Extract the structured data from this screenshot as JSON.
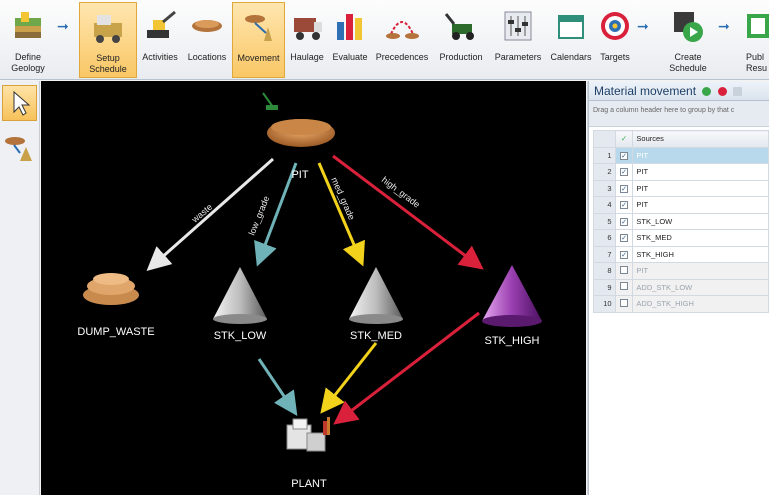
{
  "ribbon": {
    "buttons": [
      {
        "id": "define-geology",
        "label": "Define Geology",
        "icon": "geology-block-icon"
      },
      {
        "id": "setup-schedule",
        "label": "Setup Schedule",
        "icon": "truck-setup-icon"
      },
      {
        "id": "activities",
        "label": "Activities",
        "icon": "excavator-icon"
      },
      {
        "id": "locations",
        "label": "Locations",
        "icon": "pit-bowl-icon"
      },
      {
        "id": "movement",
        "label": "Movement",
        "icon": "movement-icon"
      },
      {
        "id": "haulage",
        "label": "Haulage",
        "icon": "haul-truck-icon"
      },
      {
        "id": "evaluate",
        "label": "Evaluate",
        "icon": "bar-evaluate-icon"
      },
      {
        "id": "precedences",
        "label": "Precedences",
        "icon": "precedence-icon"
      },
      {
        "id": "production",
        "label": "Production",
        "icon": "loader-icon"
      },
      {
        "id": "parameters",
        "label": "Parameters",
        "icon": "sliders-icon"
      },
      {
        "id": "calendars",
        "label": "Calendars",
        "icon": "calendar-icon"
      },
      {
        "id": "targets",
        "label": "Targets",
        "icon": "target-icon"
      },
      {
        "id": "create-schedule",
        "label": "Create Schedule",
        "icon": "play-schedule-icon"
      },
      {
        "id": "publish-results",
        "label": "Publ Resu",
        "icon": "publish-icon"
      }
    ]
  },
  "leftbar": {
    "tools": [
      {
        "name": "select-pointer-icon",
        "selected": true
      },
      {
        "name": "add-location-icon",
        "selected": false
      }
    ]
  },
  "diagram": {
    "nodes": {
      "pit": "PIT",
      "dump_waste": "DUMP_WASTE",
      "stk_low": "STK_LOW",
      "stk_med": "STK_MED",
      "stk_high": "STK_HIGH",
      "plant": "PLANT"
    },
    "edges": {
      "waste": "waste",
      "low_grade": "low_grade",
      "med_grade": "med_grade",
      "high_grade": "high_grade"
    },
    "colors": {
      "waste": "#e8e8e8",
      "low": "#6fb3b8",
      "med": "#f2d21b",
      "high": "#d9213b"
    }
  },
  "panel": {
    "title": "Material movement",
    "group_hint": "Drag a column header here to group by that c",
    "columns": {
      "check": "✓",
      "sources": "Sources"
    },
    "rows": [
      {
        "num": "1",
        "source": "PIT",
        "checked": true,
        "selected": true,
        "dim": false
      },
      {
        "num": "2",
        "source": "PIT",
        "checked": true,
        "selected": false,
        "dim": false
      },
      {
        "num": "3",
        "source": "PIT",
        "checked": true,
        "selected": false,
        "dim": false
      },
      {
        "num": "4",
        "source": "PIT",
        "checked": true,
        "selected": false,
        "dim": false
      },
      {
        "num": "5",
        "source": "STK_LOW",
        "checked": true,
        "selected": false,
        "dim": false
      },
      {
        "num": "6",
        "source": "STK_MED",
        "checked": true,
        "selected": false,
        "dim": false
      },
      {
        "num": "7",
        "source": "STK_HIGH",
        "checked": true,
        "selected": false,
        "dim": false
      },
      {
        "num": "8",
        "source": "PIT",
        "checked": false,
        "selected": false,
        "dim": true
      },
      {
        "num": "9",
        "source": "ADD_STK_LOW",
        "checked": false,
        "selected": false,
        "dim": true
      },
      {
        "num": "10",
        "source": "ADD_STK_HIGH",
        "checked": false,
        "selected": false,
        "dim": true
      }
    ]
  }
}
